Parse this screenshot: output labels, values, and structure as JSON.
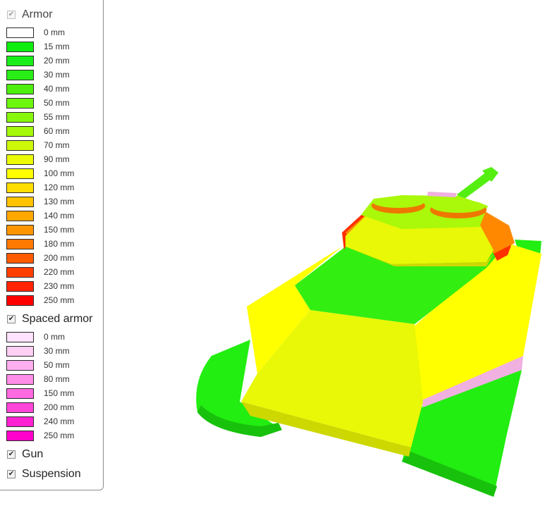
{
  "legend": {
    "armor": {
      "label": "Armor",
      "checked": true,
      "items": [
        {
          "label": "0 mm",
          "color": "#ffffff"
        },
        {
          "label": "15 mm",
          "color": "#10ee10"
        },
        {
          "label": "20 mm",
          "color": "#1aee1a"
        },
        {
          "label": "30 mm",
          "color": "#29ee16"
        },
        {
          "label": "40 mm",
          "color": "#4ef00f"
        },
        {
          "label": "50 mm",
          "color": "#6ef70e"
        },
        {
          "label": "55 mm",
          "color": "#87f70c"
        },
        {
          "label": "60 mm",
          "color": "#a6f90a"
        },
        {
          "label": "70 mm",
          "color": "#cdf808"
        },
        {
          "label": "90 mm",
          "color": "#ecfa05"
        },
        {
          "label": "100 mm",
          "color": "#ffff00"
        },
        {
          "label": "120 mm",
          "color": "#ffde00"
        },
        {
          "label": "130 mm",
          "color": "#ffc300"
        },
        {
          "label": "140 mm",
          "color": "#ffa800"
        },
        {
          "label": "150 mm",
          "color": "#ff9600"
        },
        {
          "label": "180 mm",
          "color": "#ff7a00"
        },
        {
          "label": "200 mm",
          "color": "#ff5b00"
        },
        {
          "label": "220 mm",
          "color": "#ff3f00"
        },
        {
          "label": "230 mm",
          "color": "#ff2300"
        },
        {
          "label": "250 mm",
          "color": "#ff0000"
        }
      ]
    },
    "spaced_armor": {
      "label": "Spaced armor",
      "checked": true,
      "items": [
        {
          "label": "0 mm",
          "color": "#ffe2fb"
        },
        {
          "label": "30 mm",
          "color": "#ffcff4"
        },
        {
          "label": "50 mm",
          "color": "#ffaff0"
        },
        {
          "label": "80 mm",
          "color": "#ff8ee9"
        },
        {
          "label": "150 mm",
          "color": "#ff6ae2"
        },
        {
          "label": "200 mm",
          "color": "#ff45da"
        },
        {
          "label": "240 mm",
          "color": "#ff22d3"
        },
        {
          "label": "250 mm",
          "color": "#ff00cc"
        }
      ]
    },
    "gun": {
      "label": "Gun",
      "checked": true
    },
    "suspension": {
      "label": "Suspension",
      "checked": true
    }
  },
  "model_colors": {
    "track_green": "#22ee11",
    "track_dark": "#18c10c",
    "hull_green": "#33ee11",
    "hull_yellow": "#ffff00",
    "hull_yellow_alt": "#e8f806",
    "hull_lower_yellow": "#cdd800",
    "turret_yellow": "#e8f806",
    "turret_top": "#aaf80a",
    "hatch_orange": "#ee7700",
    "cheek_orange": "#ff8800",
    "cheek_red": "#ff3000",
    "gun_green": "#55ee11",
    "spaced_pink": "#f0b0e0"
  }
}
